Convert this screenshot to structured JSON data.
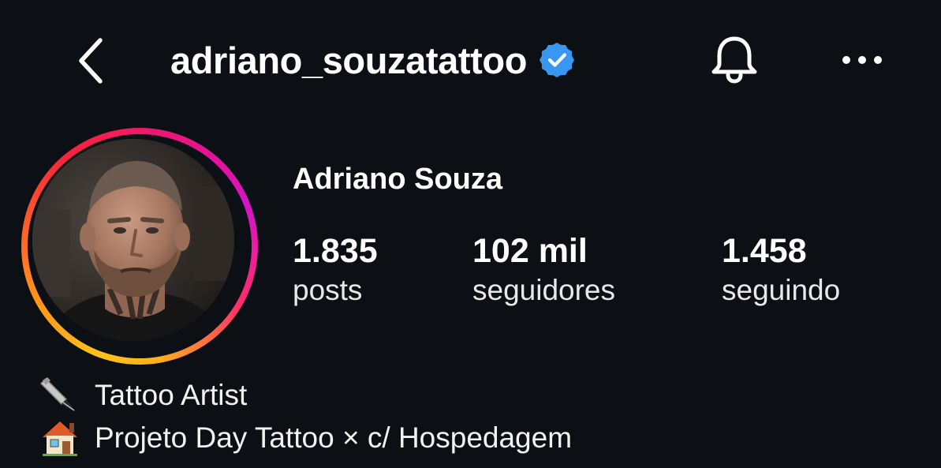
{
  "header": {
    "username": "adriano_souzatattoo",
    "verified": true,
    "back_icon": "chevron-left-icon",
    "notifications_icon": "bell-icon",
    "more_icon": "more-horizontal-icon"
  },
  "profile": {
    "full_name": "Adriano Souza",
    "stats": {
      "posts": {
        "value": "1.835",
        "label": "posts"
      },
      "followers": {
        "value": "102 mil",
        "label": "seguidores"
      },
      "following": {
        "value": "1.458",
        "label": "seguindo"
      }
    },
    "bio": [
      {
        "icon": "pen-nib-emoji",
        "text": "Tattoo Artist"
      },
      {
        "icon": "house-emoji",
        "text": "Projeto Day Tattoo × c/ Hospedagem"
      }
    ]
  },
  "colors": {
    "background": "#0c0f14",
    "text": "#ffffff",
    "verified_badge": "#3897f0",
    "story_ring_start": "#ffc21a",
    "story_ring_end": "#d514c6"
  }
}
